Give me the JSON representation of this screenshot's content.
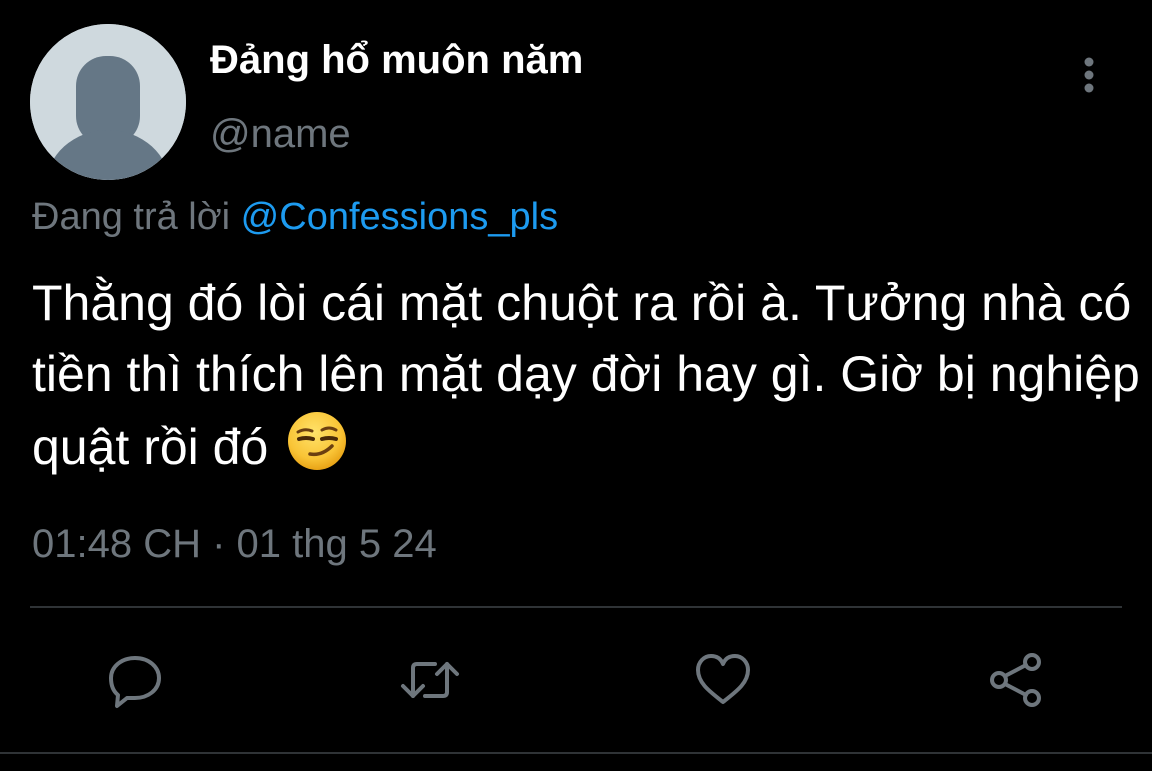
{
  "user": {
    "display_name": "Đảng hổ muôn năm",
    "handle": "@name"
  },
  "reply": {
    "prefix": "Đang trả lời",
    "mention": "@Confessions_pls"
  },
  "tweet": {
    "text": "Thằng đó lòi cái mặt chuột ra rồi à. Tưởng nhà có tiền thì thích lên mặt dạy đời hay gì. Giờ bị nghiệp quật rồi đó",
    "emoji": "smirking-face-emoji",
    "timestamp": "01:48 CH · 01 thg 5 24"
  },
  "actions": [
    "reply-icon",
    "retweet-icon",
    "like-icon",
    "share-icon"
  ],
  "colors": {
    "background": "#000000",
    "text": "#ffffff",
    "muted": "#6e767d",
    "link": "#1d9bf0",
    "divider": "#2f3336",
    "avatar_bg": "#cfd9de",
    "avatar_fg": "#657786"
  }
}
